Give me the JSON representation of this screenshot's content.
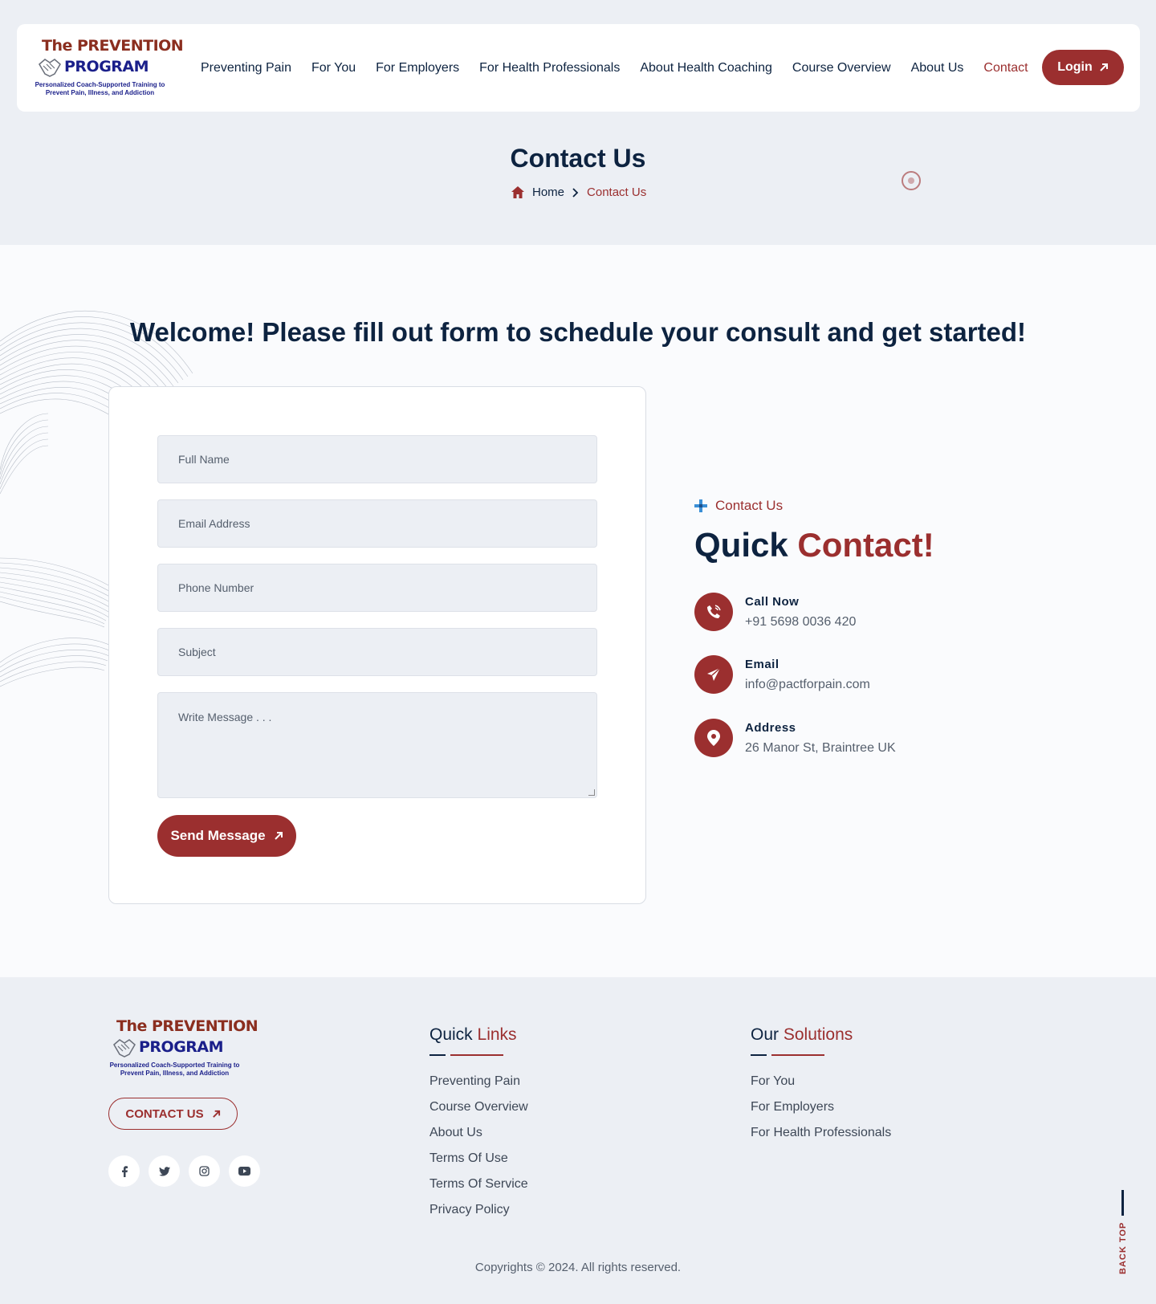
{
  "header": {
    "logo": {
      "line1": "The PREVENTION",
      "line2": "PROGRAM",
      "tagline1": "Personalized Coach-Supported Training to",
      "tagline2": "Prevent Pain, Illness, and Addiction"
    },
    "nav": [
      {
        "label": "Preventing Pain"
      },
      {
        "label": "For You"
      },
      {
        "label": "For Employers"
      },
      {
        "label": "For Health Professionals"
      },
      {
        "label": "About Health Coaching"
      },
      {
        "label": "Course Overview"
      },
      {
        "label": "About Us"
      },
      {
        "label": "Contact"
      }
    ],
    "login_label": "Login"
  },
  "page_title": "Contact Us",
  "breadcrumb": {
    "home": "Home",
    "current": "Contact Us"
  },
  "welcome": "Welcome! Please fill out form to schedule your consult and get started!",
  "form": {
    "full_name": "Full Name",
    "email": "Email Address",
    "phone": "Phone Number",
    "subject": "Subject",
    "message": "Write Message . . .",
    "send_label": "Send Message"
  },
  "quick_contact": {
    "tag": "Contact Us",
    "title_a": "Quick",
    "title_b": "Contact!",
    "items": [
      {
        "label": "Call Now",
        "value": "+91 5698 0036 420",
        "icon": "phone-icon"
      },
      {
        "label": "Email",
        "value": "info@pactforpain.com",
        "icon": "paper-plane-icon"
      },
      {
        "label": "Address",
        "value": "26 Manor St, Braintree UK",
        "icon": "location-pin-icon"
      }
    ]
  },
  "footer": {
    "contact_label": "CONTACT US",
    "quick_links": {
      "title_a": "Quick",
      "title_b": "Links",
      "items": [
        "Preventing Pain",
        "Course Overview",
        "About Us",
        "Terms Of Use",
        "Terms Of Service",
        "Privacy Policy"
      ]
    },
    "solutions": {
      "title_a": "Our",
      "title_b": "Solutions",
      "items": [
        "For You",
        "For Employers",
        "For Health Professionals"
      ]
    },
    "socials": [
      "facebook-icon",
      "twitter-icon",
      "instagram-icon",
      "youtube-icon"
    ],
    "copyright": "Copyrights © 2024. All rights reserved.",
    "back_top": "BACK TOP"
  },
  "colors": {
    "brand": "#9b2f2f",
    "navy": "#0d2340",
    "background": "#eceff4"
  }
}
